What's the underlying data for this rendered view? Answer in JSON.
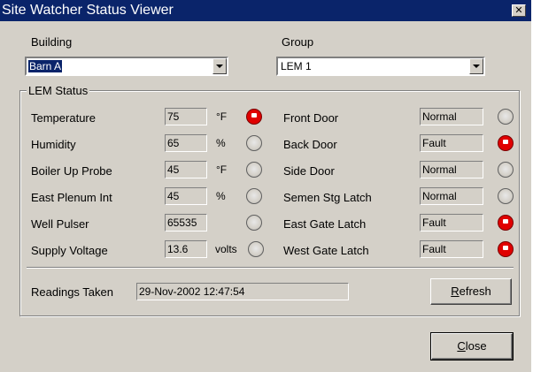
{
  "window": {
    "title": "Site Watcher Status Viewer",
    "close_glyph": "✕"
  },
  "building": {
    "label": "Building",
    "selected": "Barn A"
  },
  "group": {
    "label": "Group",
    "selected": "LEM 1"
  },
  "lem_status": {
    "legend": "LEM Status",
    "sensors": [
      {
        "label": "Temperature",
        "value": "75",
        "unit": "°F",
        "alarm": true
      },
      {
        "label": "Humidity",
        "value": "65",
        "unit": "%",
        "alarm": false
      },
      {
        "label": "Boiler Up Probe",
        "value": "45",
        "unit": "°F",
        "alarm": false
      },
      {
        "label": "East Plenum Int",
        "value": "45",
        "unit": "%",
        "alarm": false
      },
      {
        "label": "Well Pulser",
        "value": "65535",
        "unit": "",
        "alarm": false
      },
      {
        "label": "Supply Voltage",
        "value": "13.6",
        "unit": "volts",
        "alarm": false
      }
    ],
    "doors": [
      {
        "label": "Front Door",
        "status": "Normal",
        "alarm": false
      },
      {
        "label": "Back Door",
        "status": "Fault",
        "alarm": true
      },
      {
        "label": "Side Door",
        "status": "Normal",
        "alarm": false
      },
      {
        "label": "Semen Stg Latch",
        "status": "Normal",
        "alarm": false
      },
      {
        "label": "East Gate Latch",
        "status": "Fault",
        "alarm": true
      },
      {
        "label": "West Gate Latch",
        "status": "Fault",
        "alarm": true
      }
    ]
  },
  "readings": {
    "label": "Readings Taken",
    "value": "29-Nov-2002 12:47:54"
  },
  "buttons": {
    "refresh": {
      "mnemonic": "R",
      "rest": "efresh"
    },
    "close": {
      "mnemonic": "C",
      "rest": "lose"
    }
  },
  "colors": {
    "title_bar": "#0a246a",
    "dialog_face": "#d4d0c8",
    "alarm_led": "#e00000"
  }
}
